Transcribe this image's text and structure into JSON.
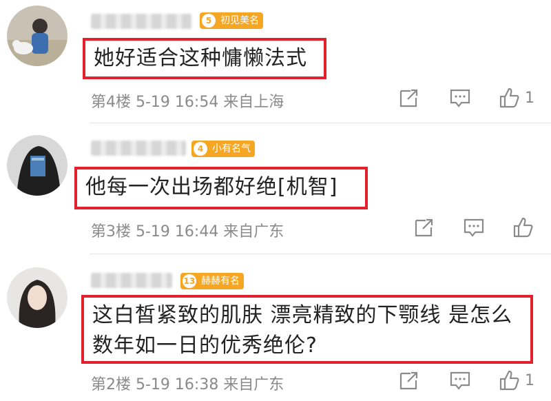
{
  "comments": [
    {
      "badge": {
        "level": "5",
        "label": "初见美名",
        "color": "#f5a623"
      },
      "text_lines": [
        "她好适合这种慵懒法式"
      ],
      "meta": "第4楼 5-19 16:54 来自上海",
      "like_count": "1"
    },
    {
      "badge": {
        "level": "4",
        "label": "小有名气",
        "color": "#f5a623"
      },
      "text_lines": [
        "他每一次出场都好绝[机智]"
      ],
      "meta": "第3楼 5-19 16:44 来自广东",
      "like_count": ""
    },
    {
      "badge": {
        "level": "13",
        "label": "赫赫有名",
        "color": "#f5a623"
      },
      "text_lines": [
        "这白皙紧致的肌肤 漂亮精致的下颚线 是怎么",
        "数年如一日的优秀绝伦?"
      ],
      "meta": "第2楼 5-19 16:38 来自广东",
      "like_count": "1"
    }
  ],
  "icons": {
    "share": "share-icon",
    "comment": "comment-icon",
    "like": "thumbs-up-icon"
  },
  "colors": {
    "highlight_border": "#e5202e",
    "meta_text": "#8a8a8a",
    "badge": "#f5a623"
  }
}
